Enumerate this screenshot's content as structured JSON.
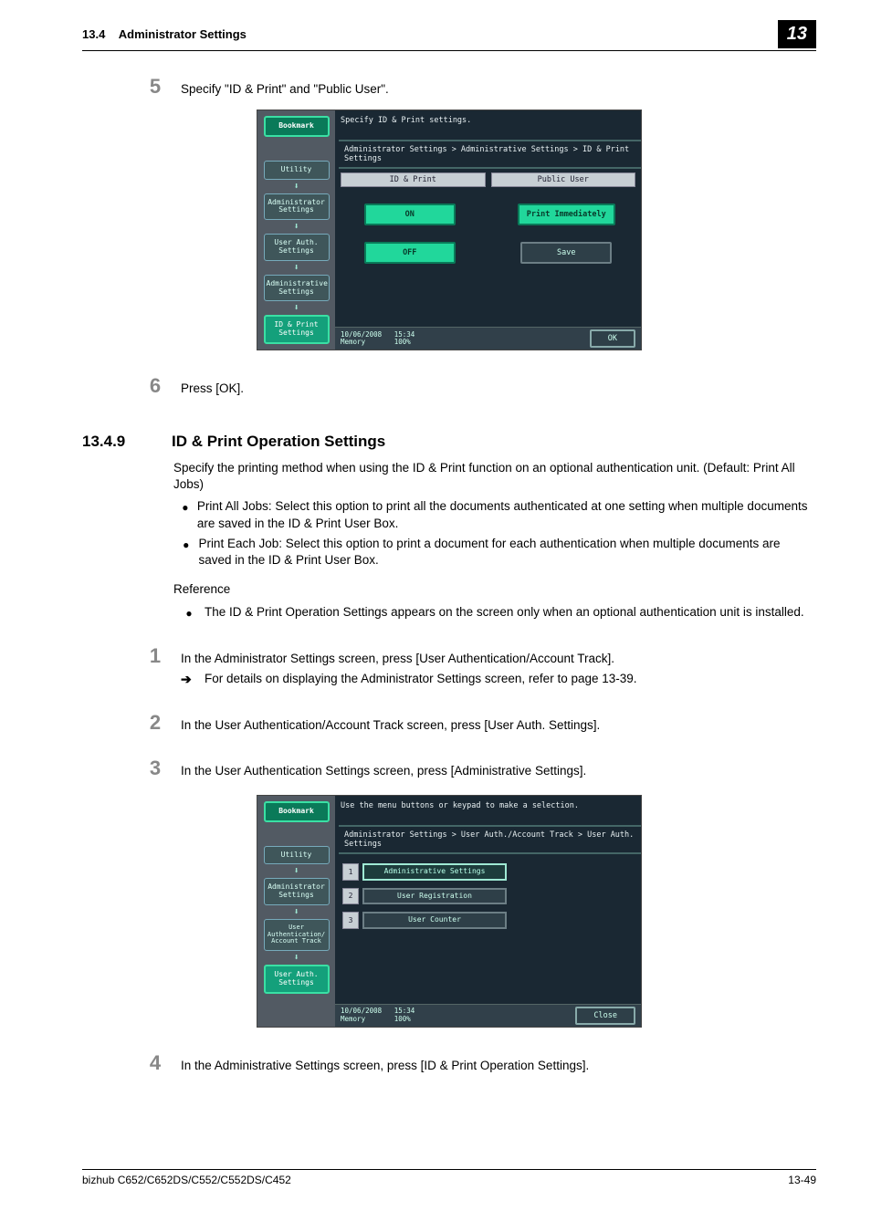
{
  "header": {
    "section_num": "13.4",
    "section_title": "Administrator Settings",
    "page_badge": "13"
  },
  "step5": {
    "num": "5",
    "text": "Specify \"ID & Print\" and \"Public User\"."
  },
  "shot1": {
    "topmsg": "Specify ID & Print settings.",
    "crumb": "Administrator Settings > Administrative Settings > ID & Print Settings",
    "sidebar": {
      "bookmark": "Bookmark",
      "items": [
        "Utility",
        "Administrator Settings",
        "User Auth. Settings",
        "Administrative Settings",
        "ID & Print Settings"
      ]
    },
    "col_a": "ID & Print",
    "col_b": "Public User",
    "btn_on": "ON",
    "btn_off": "OFF",
    "btn_print_imm": "Print Immediately",
    "btn_save": "Save",
    "status": {
      "date": "10/06/2008",
      "time": "15:34",
      "mem": "Memory",
      "mem_val": "100%"
    },
    "ok": "OK"
  },
  "step6": {
    "num": "6",
    "text": "Press [OK]."
  },
  "sec": {
    "num": "13.4.9",
    "title": "ID & Print Operation Settings"
  },
  "intro": "Specify the printing method when using the ID & Print function on an optional authentication unit. (Default: Print All Jobs)",
  "bullets": [
    "Print All Jobs: Select this option to print all the documents authenticated at one setting when multiple documents are saved in the ID & Print User Box.",
    "Print Each Job: Select this option to print a document for each authentication when multiple documents are saved in the ID & Print User Box."
  ],
  "reference_label": "Reference",
  "ref_bullets": [
    "The ID & Print Operation Settings appears on the screen only when an optional authentication unit is installed."
  ],
  "step1": {
    "num": "1",
    "text": "In the Administrator Settings screen, press [User Authentication/Account Track].",
    "sub": "For details on displaying the Administrator Settings screen, refer to page 13-39."
  },
  "step2": {
    "num": "2",
    "text": "In the User Authentication/Account Track screen, press [User Auth. Settings]."
  },
  "step3": {
    "num": "3",
    "text": "In the User Authentication Settings screen, press [Administrative Settings]."
  },
  "shot2": {
    "topmsg": "Use the menu buttons or keypad to make a selection.",
    "crumb": "Administrator Settings > User Auth./Account Track > User Auth. Settings",
    "sidebar": {
      "bookmark": "Bookmark",
      "items": [
        "Utility",
        "Administrator Settings",
        "User Authentication/ Account Track",
        "User Auth. Settings"
      ]
    },
    "menu": [
      {
        "n": "1",
        "label": "Administrative Settings"
      },
      {
        "n": "2",
        "label": "User Registration"
      },
      {
        "n": "3",
        "label": "User Counter"
      }
    ],
    "status": {
      "date": "10/06/2008",
      "time": "15:34",
      "mem": "Memory",
      "mem_val": "100%"
    },
    "close": "Close"
  },
  "step4": {
    "num": "4",
    "text": "In the Administrative Settings screen, press [ID & Print Operation Settings]."
  },
  "footer": {
    "left": "bizhub C652/C652DS/C552/C552DS/C452",
    "right": "13-49"
  }
}
